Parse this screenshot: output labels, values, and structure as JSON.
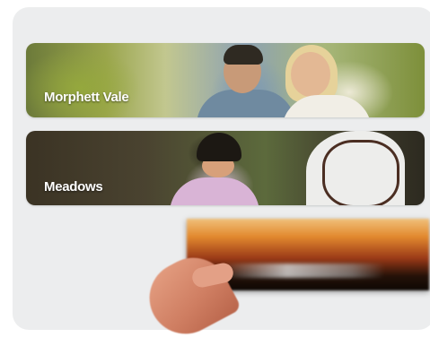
{
  "banners": [
    {
      "label": "Morphett Vale"
    },
    {
      "label": "Meadows"
    }
  ]
}
